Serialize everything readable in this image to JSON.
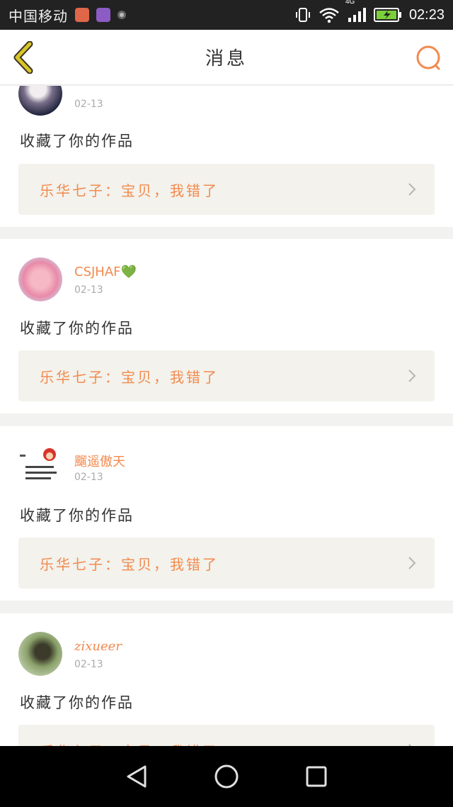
{
  "status_bar": {
    "carrier": "中国移动",
    "network": "4G",
    "time": "02:23",
    "icons": [
      "mail-app-icon",
      "gallery-app-icon",
      "circle-app-icon",
      "vibrate-icon",
      "wifi-icon",
      "signal-icon",
      "battery-charging-icon"
    ]
  },
  "header": {
    "title": "消息",
    "back_icon": "chevron-left-icon",
    "search_icon": "search-icon"
  },
  "colors": {
    "accent": "#f28a4e",
    "back_icon": "#c9b21a",
    "link_bg": "#f3f2ec",
    "separator": "#f2f2f0"
  },
  "messages": [
    {
      "username": "",
      "date": "02-13",
      "action": "收藏了你的作品",
      "work_title": "乐华七子：宝贝，我错了"
    },
    {
      "username": "CSJHAF💚",
      "date": "02-13",
      "action": "收藏了你的作品",
      "work_title": "乐华七子：宝贝，我错了"
    },
    {
      "username": "飀遥傲天",
      "date": "02-13",
      "action": "收藏了你的作品",
      "work_title": "乐华七子：宝贝，我错了"
    },
    {
      "username": "zixueer",
      "date": "02-13",
      "action": "收藏了你的作品",
      "work_title": "乐华七子：宝贝，我错了"
    }
  ],
  "nav": {
    "back": "triangle-back-icon",
    "home": "circle-home-icon",
    "recents": "square-recents-icon"
  }
}
